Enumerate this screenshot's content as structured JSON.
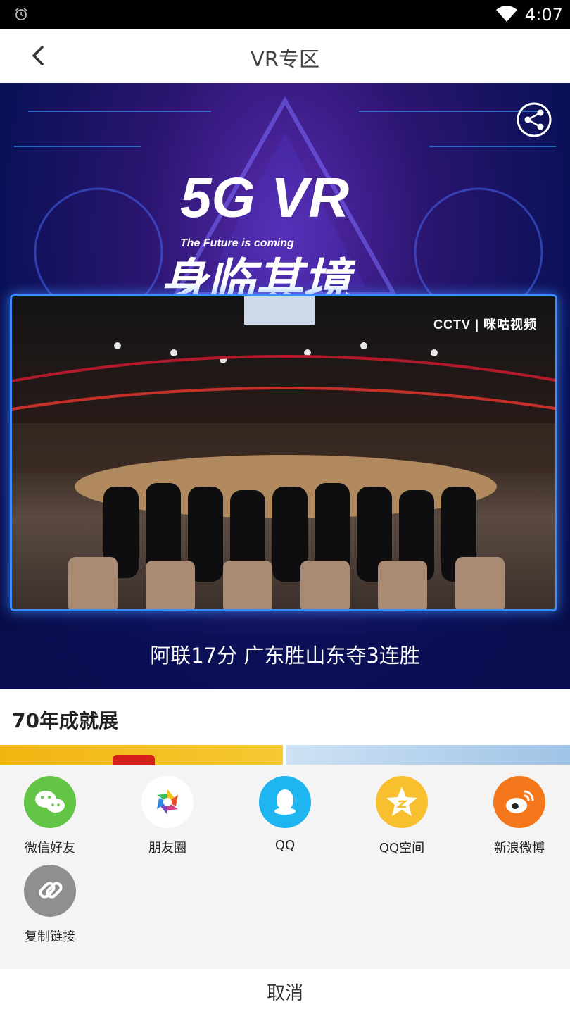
{
  "status_bar": {
    "time": "4:07",
    "icons": [
      "alarm-icon",
      "wifi-icon"
    ]
  },
  "nav": {
    "title": "VR专区",
    "back_icon": "chevron-left-icon"
  },
  "banner": {
    "brand_line": "5G VR",
    "tagline": "The Future is coming",
    "slogan": "身临其境",
    "video_watermark": "CCTV | 咪咕视频",
    "caption": "阿联17分 广东胜山东夺3连胜",
    "share_icon": "share-icon"
  },
  "section": {
    "title": "70年成就展"
  },
  "share_sheet": {
    "items": [
      {
        "label": "微信好友",
        "icon": "wechat-icon",
        "color": "#62c545"
      },
      {
        "label": "朋友圈",
        "icon": "moments-icon",
        "color": "#ffffff"
      },
      {
        "label": "QQ",
        "icon": "qq-icon",
        "color": "#1eb5f0"
      },
      {
        "label": "QQ空间",
        "icon": "qzone-icon",
        "color": "#f8c02e"
      },
      {
        "label": "新浪微博",
        "icon": "weibo-icon",
        "color": "#f5771b"
      },
      {
        "label": "复制链接",
        "icon": "link-icon",
        "color": "#8f8f8f"
      }
    ],
    "cancel_label": "取消"
  }
}
